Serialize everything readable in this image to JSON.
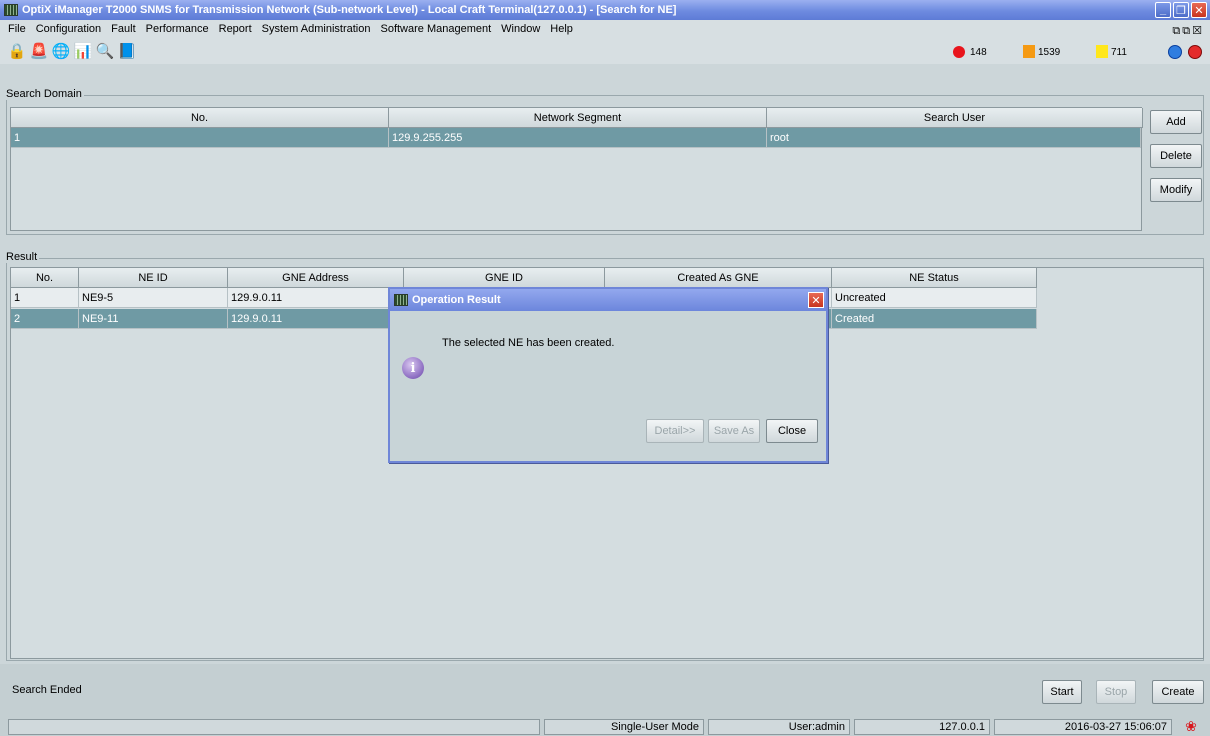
{
  "window": {
    "title": "OptiX iManager T2000 SNMS for Transmission Network (Sub-network Level) - Local Craft Terminal(127.0.0.1) - [Search for NE]",
    "minimize_glyph": "_",
    "restore_glyph": "❐",
    "close_glyph": "✕"
  },
  "menu": {
    "items": [
      "File",
      "Configuration",
      "Fault",
      "Performance",
      "Report",
      "System Administration",
      "Software Management",
      "Window",
      "Help"
    ]
  },
  "toolbar": {
    "icons": [
      "lock-icon",
      "alarm-light-icon",
      "network-icon",
      "chart-icon",
      "search-report-icon",
      "book-icon"
    ],
    "alarms": {
      "critical": "148",
      "major": "1539",
      "minor": "711"
    },
    "colors": {
      "critical": "#e8141c",
      "major": "#f59a13",
      "minor": "#ffe71c"
    }
  },
  "search_domain": {
    "label": "Search Domain",
    "columns": [
      "No.",
      "Network Segment",
      "Search User"
    ],
    "rows": [
      {
        "no": "1",
        "segment": "129.9.255.255",
        "user": "root"
      }
    ],
    "buttons": {
      "add": "Add",
      "delete": "Delete",
      "modify": "Modify"
    }
  },
  "result": {
    "label": "Result",
    "columns": [
      "No.",
      "NE ID",
      "GNE Address",
      "GNE ID",
      "Created As GNE",
      "NE Status"
    ],
    "rows": [
      {
        "no": "1",
        "ne_id": "NE9-5",
        "gne_address": "129.9.0.11",
        "gne_id": "",
        "created_as_gne": "",
        "status": "Uncreated"
      },
      {
        "no": "2",
        "ne_id": "NE9-11",
        "gne_address": "129.9.0.11",
        "gne_id": "",
        "created_as_gne": "",
        "status": "Created"
      }
    ]
  },
  "dialog": {
    "title": "Operation Result",
    "message": "The selected NE has been created.",
    "buttons": {
      "detail": "Detail>>",
      "save_as": "Save As",
      "close": "Close"
    }
  },
  "footer": {
    "status": "Search Ended",
    "buttons": {
      "start": "Start",
      "stop": "Stop",
      "create": "Create"
    }
  },
  "statusbar": {
    "mode": "Single-User Mode",
    "user": "User:admin",
    "ip": "127.0.0.1",
    "datetime": "2016-03-27 15:06:07"
  }
}
